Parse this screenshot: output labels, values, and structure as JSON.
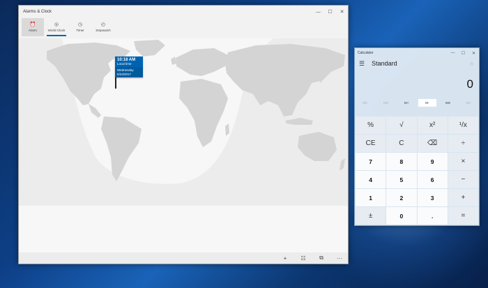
{
  "alarms_window": {
    "title": "Alarms & Clock",
    "controls": {
      "minimize": "—",
      "maximize": "☐",
      "close": "✕"
    },
    "tabs": [
      {
        "icon": "⏰",
        "label": "Alarm"
      },
      {
        "icon": "◎",
        "label": "World Clock"
      },
      {
        "icon": "◷",
        "label": "Timer"
      },
      {
        "icon": "◴",
        "label": "Stopwatch"
      }
    ],
    "location_tag": {
      "time": "10:18 AM",
      "label": "Local time",
      "day": "Wednesday",
      "date": "5/24/2017"
    },
    "command_bar": {
      "add": "+",
      "compare": "☷",
      "pin": "⧉",
      "more": "···"
    }
  },
  "calculator_window": {
    "title": "Calculator",
    "controls": {
      "minimize": "—",
      "maximize": "☐",
      "close": "✕"
    },
    "menu_icon": "☰",
    "mode": "Standard",
    "history_icon": "◷",
    "display": "0",
    "memory_buttons": [
      "MC",
      "MR",
      "M+",
      "M-",
      "MS",
      "M˅"
    ],
    "keys": [
      "%",
      "√",
      "x²",
      "¹/x",
      "CE",
      "C",
      "⌫",
      "÷",
      "7",
      "8",
      "9",
      "×",
      "4",
      "5",
      "6",
      "−",
      "1",
      "2",
      "3",
      "+",
      "±",
      "0",
      ".",
      "="
    ]
  },
  "colors": {
    "accent": "#0063b1",
    "land": "#d4d4d4",
    "night": "#e6e6e6"
  }
}
